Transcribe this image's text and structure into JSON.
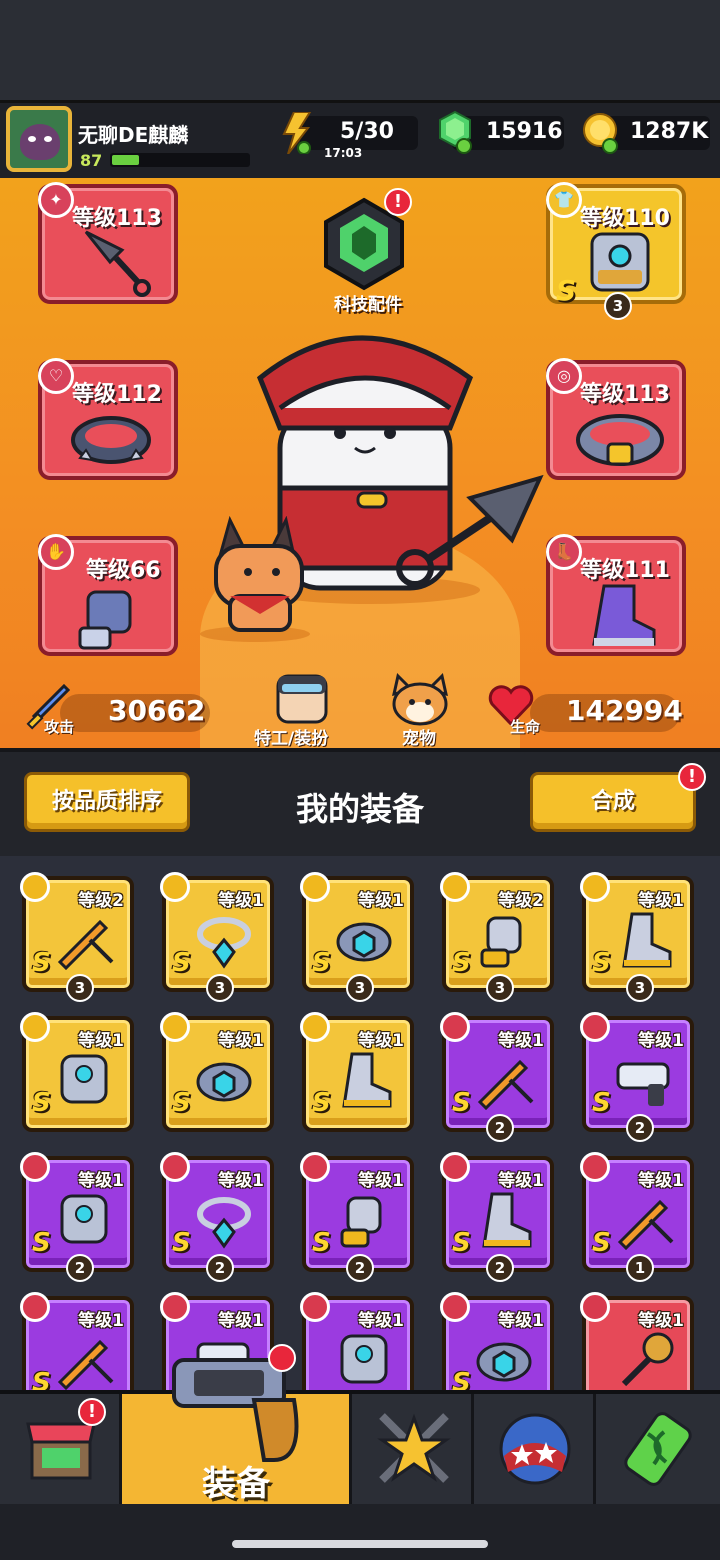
{
  "player": {
    "name": "无聊DE麒麟",
    "level": "87",
    "xp_fraction": 0.2
  },
  "resources": {
    "energy": {
      "value": "5/30",
      "timer": "17:03"
    },
    "gems": {
      "value": "15916"
    },
    "coins": {
      "value": "1287K"
    }
  },
  "equipped": {
    "weapon": {
      "level": "等级113"
    },
    "necklace": {
      "level": "等级112"
    },
    "gloves": {
      "level": "等级66"
    },
    "armor": {
      "level": "等级110",
      "rank": "S",
      "stars": "3"
    },
    "belt": {
      "level": "等级113"
    },
    "boots": {
      "level": "等级111"
    }
  },
  "tech_parts": {
    "label": "科技配件",
    "alert": "!"
  },
  "stats": {
    "attack": {
      "label": "攻击",
      "value": "30662"
    },
    "hp": {
      "label": "生命",
      "value": "142994"
    }
  },
  "hero_buttons": {
    "agent": "特工/装扮",
    "pet": "宠物"
  },
  "sortbar": {
    "sort_label": "按品质排序",
    "title": "我的装备",
    "merge_label": "合成",
    "merge_alert": "!"
  },
  "inventory": [
    {
      "rarity": "gold",
      "icon": "sword-icon",
      "level": "等级2",
      "rank": "S",
      "stars": "3"
    },
    {
      "rarity": "gold",
      "icon": "necklace-icon",
      "level": "等级1",
      "rank": "S",
      "stars": "3"
    },
    {
      "rarity": "gold",
      "icon": "belt-icon",
      "level": "等级1",
      "rank": "S",
      "stars": "3"
    },
    {
      "rarity": "gold",
      "icon": "gauntlet-icon",
      "level": "等级2",
      "rank": "S",
      "stars": "3"
    },
    {
      "rarity": "gold",
      "icon": "boot-icon",
      "level": "等级1",
      "rank": "S",
      "stars": "3"
    },
    {
      "rarity": "gold",
      "icon": "armor-icon",
      "level": "等级1",
      "rank": "S",
      "stars": ""
    },
    {
      "rarity": "gold",
      "icon": "belt-icon",
      "level": "等级1",
      "rank": "S",
      "stars": ""
    },
    {
      "rarity": "gold",
      "icon": "boot-icon",
      "level": "等级1",
      "rank": "S",
      "stars": ""
    },
    {
      "rarity": "purple",
      "icon": "sword-icon",
      "level": "等级1",
      "rank": "S",
      "stars": "2"
    },
    {
      "rarity": "purple",
      "icon": "gun-icon",
      "level": "等级1",
      "rank": "S",
      "stars": "2"
    },
    {
      "rarity": "purple",
      "icon": "armor-icon",
      "level": "等级1",
      "rank": "S",
      "stars": "2"
    },
    {
      "rarity": "purple",
      "icon": "necklace-icon",
      "level": "等级1",
      "rank": "S",
      "stars": "2"
    },
    {
      "rarity": "purple",
      "icon": "gauntlet-icon",
      "level": "等级1",
      "rank": "S",
      "stars": "2"
    },
    {
      "rarity": "purple",
      "icon": "boot-icon",
      "level": "等级1",
      "rank": "S",
      "stars": "2"
    },
    {
      "rarity": "purple",
      "icon": "sword-icon",
      "level": "等级1",
      "rank": "S",
      "stars": "1"
    },
    {
      "rarity": "purple",
      "icon": "sword-icon",
      "level": "等级1",
      "rank": "S",
      "stars": ""
    },
    {
      "rarity": "purple",
      "icon": "gun-icon",
      "level": "等级1",
      "rank": "",
      "stars": ""
    },
    {
      "rarity": "purple",
      "icon": "armor-icon",
      "level": "等级1",
      "rank": "",
      "stars": ""
    },
    {
      "rarity": "purple",
      "icon": "belt-icon",
      "level": "等级1",
      "rank": "S",
      "stars": ""
    },
    {
      "rarity": "red",
      "icon": "mace-icon",
      "level": "等级1",
      "rank": "",
      "stars": ""
    }
  ],
  "nav": {
    "tabs": [
      {
        "name": "shop",
        "icon": "shop-icon",
        "alert": "!"
      },
      {
        "name": "equipment",
        "icon": "gun-icon",
        "label": "装备",
        "active": true
      },
      {
        "name": "talents",
        "icon": "star-icon"
      },
      {
        "name": "events",
        "icon": "ball-icon"
      },
      {
        "name": "evolution",
        "icon": "dna-icon"
      }
    ]
  },
  "colors": {
    "hero_bg": "#f2a21c",
    "gold": "#f3c53a",
    "purple": "#9b3be0",
    "red": "#e64958"
  }
}
